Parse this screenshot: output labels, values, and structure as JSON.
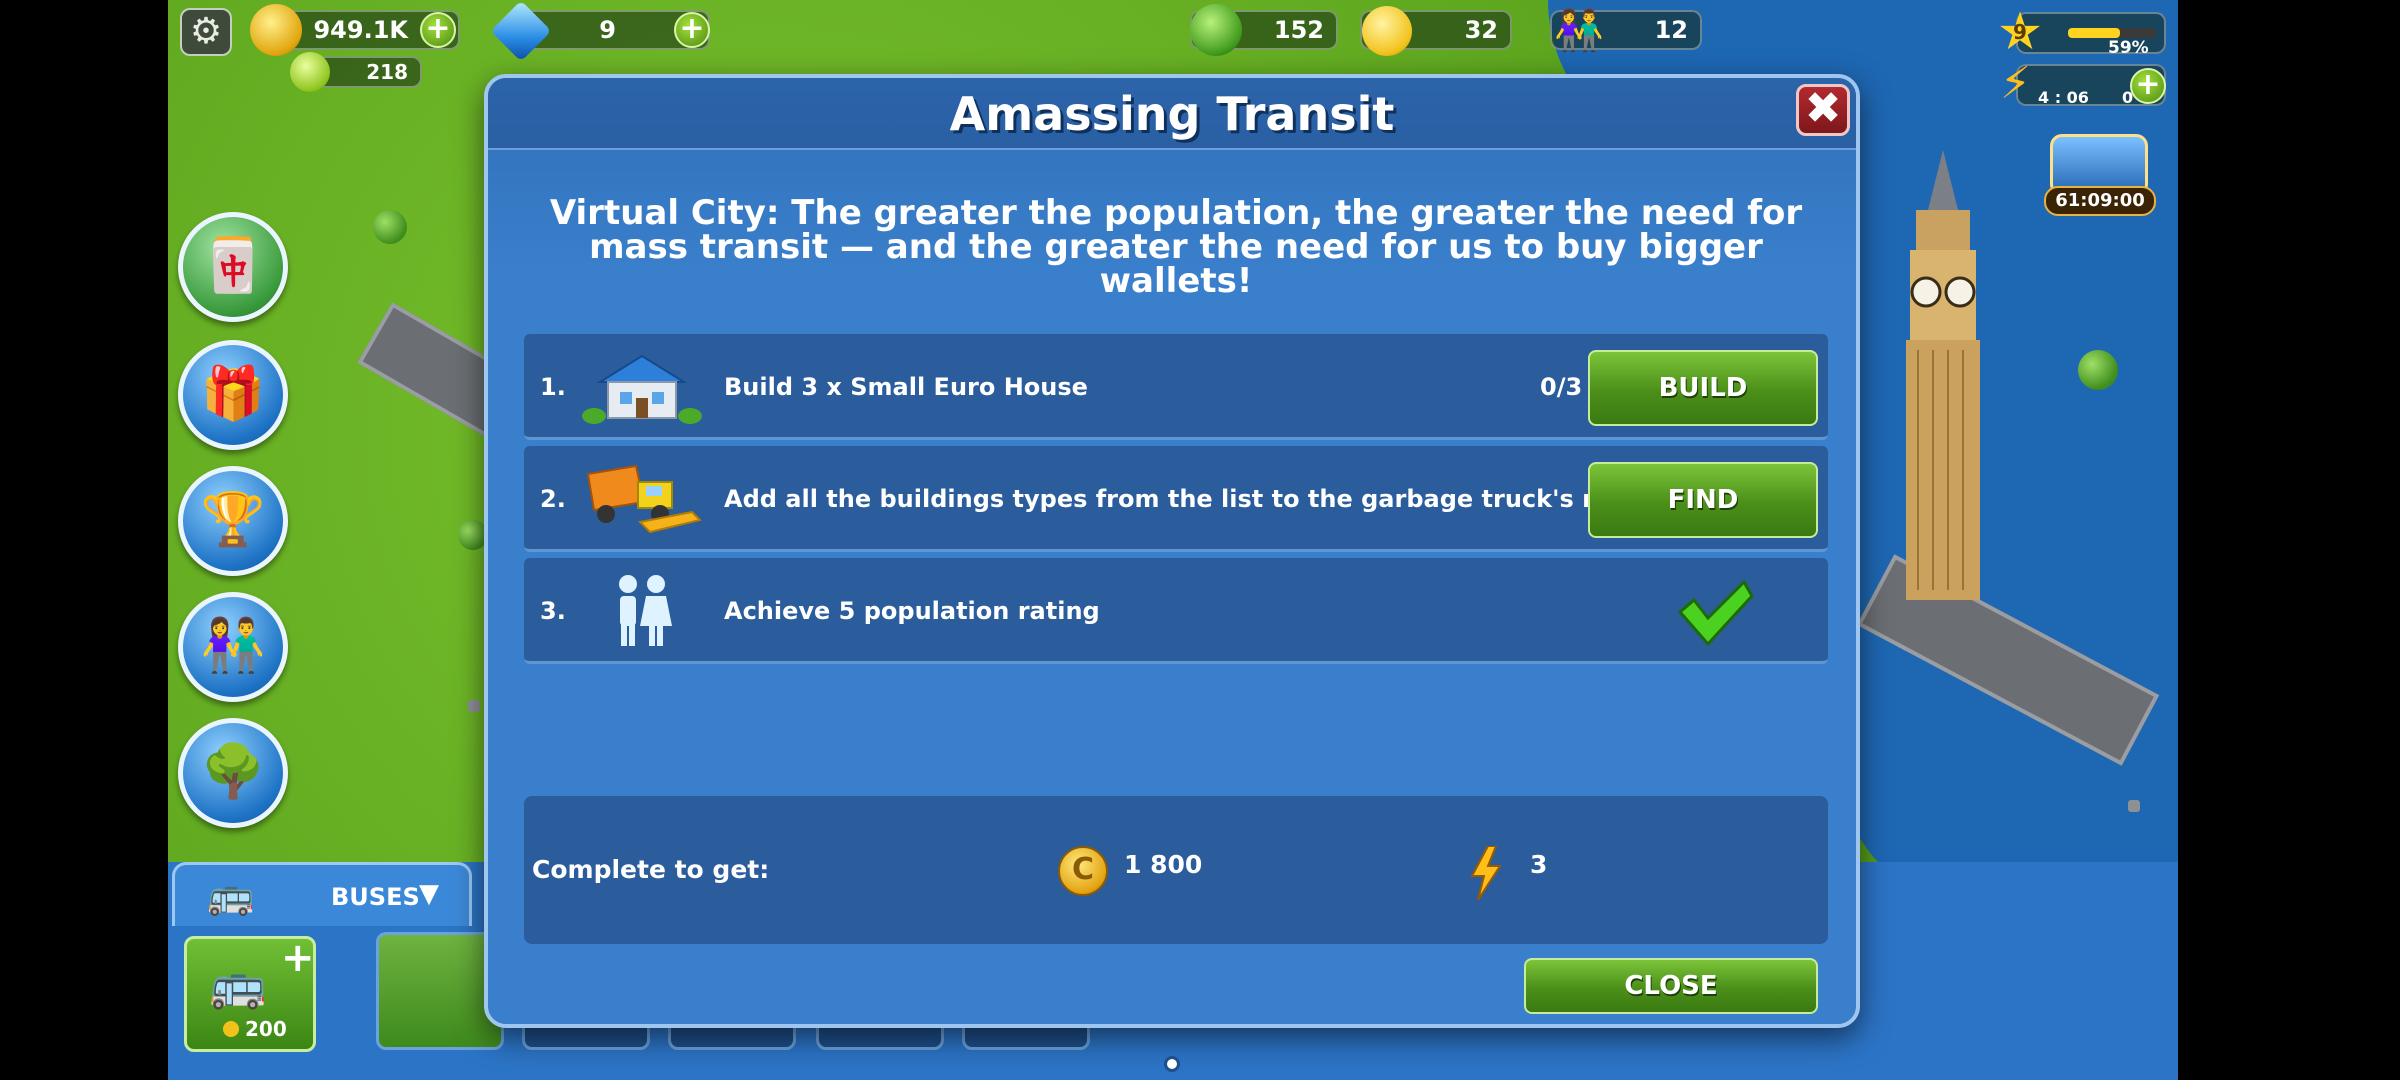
{
  "hud": {
    "coins": "949.1K",
    "gems": "9",
    "secondary_currency": "218",
    "environment": "152",
    "happiness": "32",
    "population": "12",
    "level": "9",
    "xp_percent": "59%",
    "energy_timer": "4 : 06",
    "energy": "0",
    "chest_timer": "61:09:00"
  },
  "bus_panel": {
    "tab_label": "BUSES",
    "buy_price": "200"
  },
  "modal": {
    "title": "Amassing Transit",
    "close_symbol": "✖",
    "description": "Virtual City: The greater the population, the greater the need for mass transit — and the greater the need for us to buy bigger wallets!",
    "tasks": [
      {
        "number": "1.",
        "text": "Build 3 x Small Euro House",
        "progress": "0/3",
        "action": "BUILD",
        "icon": "house-icon"
      },
      {
        "number": "2.",
        "text": "Add all the buildings types from the list to the garbage truck's route",
        "progress": "",
        "action": "FIND",
        "icon": "garbage-truck-icon"
      },
      {
        "number": "3.",
        "text": "Achieve 5 population rating",
        "progress": "",
        "action": "",
        "icon": "population-icon",
        "completed": true
      }
    ],
    "reward": {
      "label": "Complete to get:",
      "coins": "1 800",
      "energy": "3"
    },
    "close_button": "CLOSE"
  },
  "colors": {
    "modal_bg": "#3a7fcb",
    "row_bg": "#2b5c9b",
    "button_green": "#4b8f19",
    "close_red": "#b12a2f"
  }
}
